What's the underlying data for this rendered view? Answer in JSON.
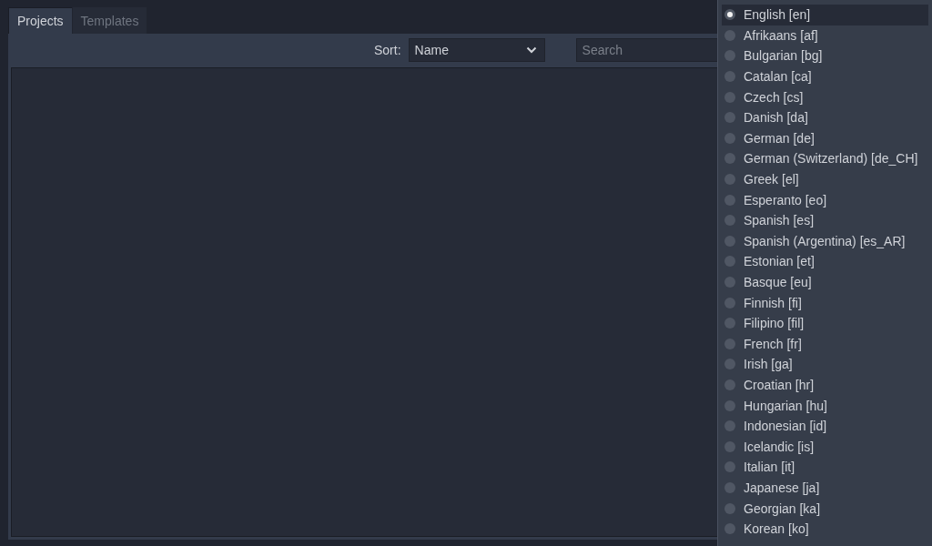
{
  "tabs": [
    {
      "label": "Projects",
      "selected": true
    },
    {
      "label": "Templates",
      "selected": false
    }
  ],
  "toolbar": {
    "sort_label": "Sort:",
    "sort_value": "Name",
    "search": {
      "placeholder": "Search"
    }
  },
  "language_menu": [
    {
      "label": "English [en]",
      "selected": true
    },
    {
      "label": "Afrikaans [af]",
      "selected": false
    },
    {
      "label": "Bulgarian [bg]",
      "selected": false
    },
    {
      "label": "Catalan [ca]",
      "selected": false
    },
    {
      "label": "Czech [cs]",
      "selected": false
    },
    {
      "label": "Danish [da]",
      "selected": false
    },
    {
      "label": "German [de]",
      "selected": false
    },
    {
      "label": "German (Switzerland) [de_CH]",
      "selected": false
    },
    {
      "label": "Greek [el]",
      "selected": false
    },
    {
      "label": "Esperanto [eo]",
      "selected": false
    },
    {
      "label": "Spanish [es]",
      "selected": false
    },
    {
      "label": "Spanish (Argentina) [es_AR]",
      "selected": false
    },
    {
      "label": "Estonian [et]",
      "selected": false
    },
    {
      "label": "Basque [eu]",
      "selected": false
    },
    {
      "label": "Finnish [fi]",
      "selected": false
    },
    {
      "label": "Filipino [fil]",
      "selected": false
    },
    {
      "label": "French [fr]",
      "selected": false
    },
    {
      "label": "Irish [ga]",
      "selected": false
    },
    {
      "label": "Croatian [hr]",
      "selected": false
    },
    {
      "label": "Hungarian [hu]",
      "selected": false
    },
    {
      "label": "Indonesian [id]",
      "selected": false
    },
    {
      "label": "Icelandic [is]",
      "selected": false
    },
    {
      "label": "Italian [it]",
      "selected": false
    },
    {
      "label": "Japanese [ja]",
      "selected": false
    },
    {
      "label": "Georgian [ka]",
      "selected": false
    },
    {
      "label": "Korean [ko]",
      "selected": false
    }
  ]
}
